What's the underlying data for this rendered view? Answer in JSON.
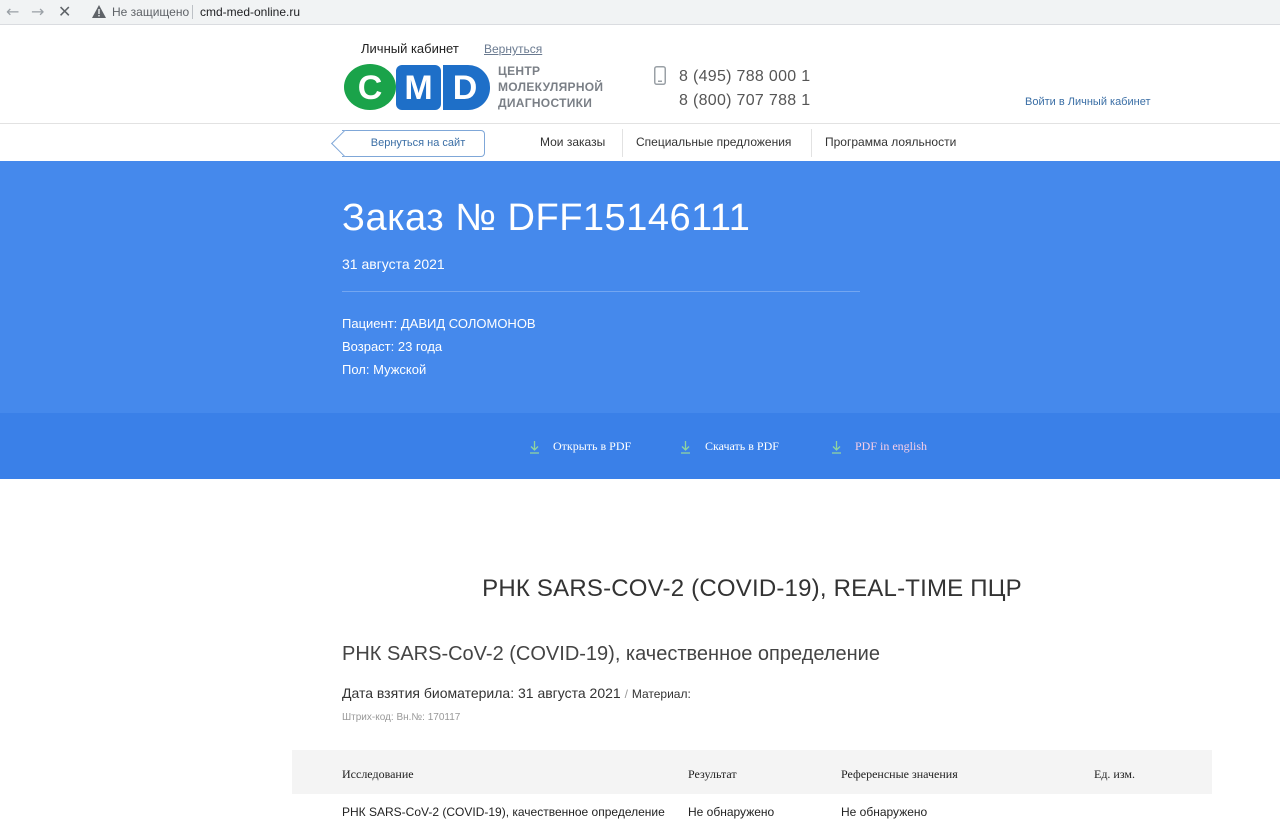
{
  "browser": {
    "back_icon": "arrow-left-icon",
    "forward_icon": "arrow-right-icon",
    "stop_icon": "close-icon",
    "security_label": "Не защищено",
    "url": "cmd-med-online.ru"
  },
  "header": {
    "cabinet_label": "Личный кабинет",
    "back_link": "Вернуться",
    "logo": {
      "letters": "CMD",
      "colors": [
        "#1aa34a",
        "#1e6fc8",
        "#1e6fc8"
      ]
    },
    "logo_lines": [
      "ЦЕНТР",
      "МОЛЕКУЛЯРНОЙ",
      "ДИАГНОСТИКИ"
    ],
    "phones": [
      "8 (495) 788 000 1",
      "8 (800) 707 788 1"
    ],
    "login_link": "Войти в Личный кабинет"
  },
  "nav": {
    "back_site_button": "Вернуться на сайт",
    "items": [
      "Мои заказы",
      "Специальные предложения",
      "Программа лояльности"
    ]
  },
  "order": {
    "title": "Заказ № DFF15146111",
    "date": "31 августа 2021",
    "patient": "Пациент: ДАВИД СОЛОМОНОВ",
    "age": "Возраст: 23 года",
    "sex": "Пол: Мужской"
  },
  "pdf": {
    "open": "Открыть в PDF",
    "download": "Скачать в PDF",
    "english": "PDF in english"
  },
  "test": {
    "title": "РНК SARS-COV-2 (COVID-19), REAL-TIME ПЦР",
    "subtitle": "РНК SARS-CoV-2 (COVID-19), качественное определение",
    "sample_date": "Дата взятия биоматерила: 31 августа 2021",
    "slash": "/",
    "material": "Материал:",
    "barcode": "Штрих-код: Вн.№: 170117"
  },
  "table": {
    "headers": [
      "Исследование",
      "Результат",
      "Референсные значения",
      "Ед. изм."
    ],
    "rows": [
      [
        "РНК SARS-CoV-2 (COVID-19), качественное определение",
        "Не обнаружено",
        "Не обнаружено",
        ""
      ]
    ]
  },
  "colors": {
    "band": "#4589ec",
    "pdf_band": "#3a80e8",
    "link": "#3a6ea5"
  }
}
